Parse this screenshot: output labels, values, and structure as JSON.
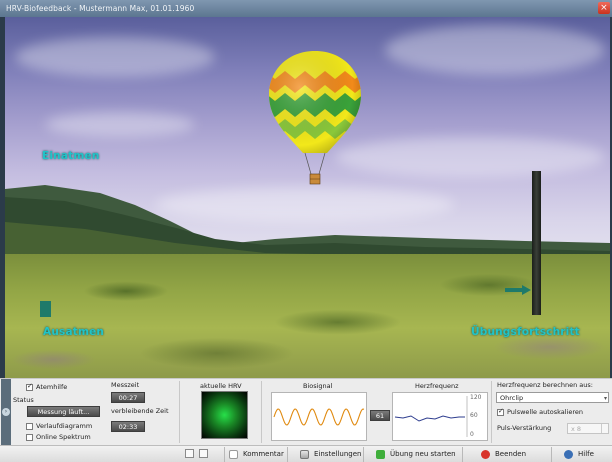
{
  "window": {
    "title": "HRV-Biofeedback - Mustermann Max, 01.01.1960",
    "close_label": "×"
  },
  "scene": {
    "inhale_label": "Einatmen",
    "exhale_label": "Ausatmen",
    "progress_label": "Übungsfortschritt"
  },
  "panel": {
    "breathing_aid": {
      "label": "Atemhilfe",
      "checked": true
    },
    "status_label": "Status",
    "status_button": "Messung läuft...",
    "progress_diagram": {
      "label": "Verlaufdiagramm",
      "checked": false
    },
    "online_spectrum": {
      "label": "Online Spektrum",
      "checked": false
    },
    "measure_time_label": "Messzeit",
    "measure_time_value": "00:27",
    "remaining_time_label": "verbleibende Zeit",
    "remaining_time_value": "02:33",
    "current_hrv_label": "aktuelle HRV",
    "biosignal_label": "Biosignal",
    "heart_rate_label": "Herzfrequenz",
    "heart_rate_value": "61",
    "hr_axis": [
      "120",
      "60",
      "0"
    ],
    "hr_source_label": "Herzfrequenz berechnen aus:",
    "hr_source_value": "Ohrclip",
    "autoscale": {
      "label": "Pulswelle autoskalieren",
      "checked": true
    },
    "gain_label": "Puls-Verstärkung",
    "gain_value": "x 8"
  },
  "toolbar": {
    "comment": "Kommentar",
    "settings": "Einstellungen",
    "restart": "Übung neu starten",
    "end": "Beenden",
    "help": "Hilfe"
  },
  "colors": {
    "scene_label": "#20c4c8",
    "hrv_indicator": "#27e04a",
    "end_icon": "#d8342a",
    "restart_icon": "#3fae3b",
    "help_icon": "#3a6fb5"
  }
}
